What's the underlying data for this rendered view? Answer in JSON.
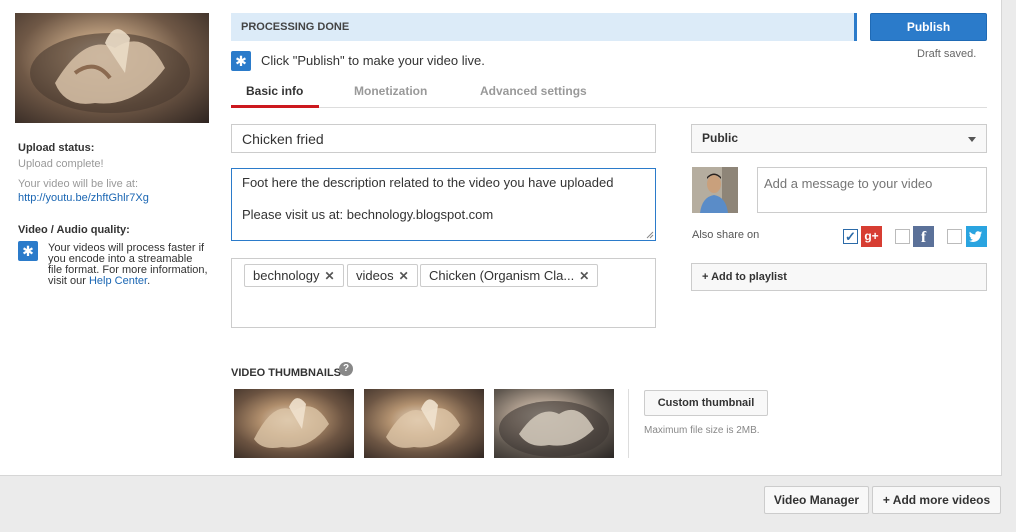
{
  "upload_status": {
    "title": "Upload status:",
    "status": "Upload complete!",
    "live_text": "Your video will be live at:",
    "link": "http://youtu.be/zhftGhlr7Xg"
  },
  "quality": {
    "title": "Video / Audio quality:",
    "text": "Your videos will process faster if you encode into a streamable file format. For more information, visit our ",
    "link": "Help Center",
    "suffix": "."
  },
  "processing": {
    "label": "PROCESSING DONE"
  },
  "publish": {
    "label": "Publish",
    "draft": "Draft saved."
  },
  "click_notice": "Click \"Publish\" to make your video live.",
  "tabs": [
    {
      "label": "Basic info",
      "active": true
    },
    {
      "label": "Monetization",
      "active": false
    },
    {
      "label": "Advanced settings",
      "active": false
    }
  ],
  "form": {
    "title_value": "Chicken fried",
    "description_value": "Foot here the description related to the video you have uploaded\n\nPlease visit us at: bechnology.blogspot.com",
    "tags": [
      "bechnology",
      "videos",
      "Chicken (Organism Cla..."
    ]
  },
  "privacy": {
    "value": "Public"
  },
  "message": {
    "placeholder": "Add a message to your video"
  },
  "share": {
    "label": "Also share on",
    "gplus_checked": true,
    "facebook_checked": false,
    "twitter_checked": false,
    "gplus_icon": "g+",
    "facebook_icon": "f"
  },
  "playlist": {
    "label": "+ Add to playlist"
  },
  "thumbnails": {
    "title": "VIDEO THUMBNAILS",
    "help": "?",
    "custom_label": "Custom thumbnail",
    "max_size": "Maximum file size is 2MB."
  },
  "footer": {
    "video_manager": "Video Manager",
    "add_more": "+ Add more videos"
  },
  "colors": {
    "accent_blue": "#2b7bca",
    "tab_red": "#cc181e",
    "gplus_red": "#d73d32",
    "facebook_blue": "#5b7199",
    "twitter_blue": "#2aa4e0"
  },
  "icons": [
    "star-icon",
    "chevron-down-icon",
    "checkmark-icon",
    "google-plus-icon",
    "facebook-icon",
    "twitter-icon",
    "question-icon",
    "remove-tag-icon"
  ]
}
